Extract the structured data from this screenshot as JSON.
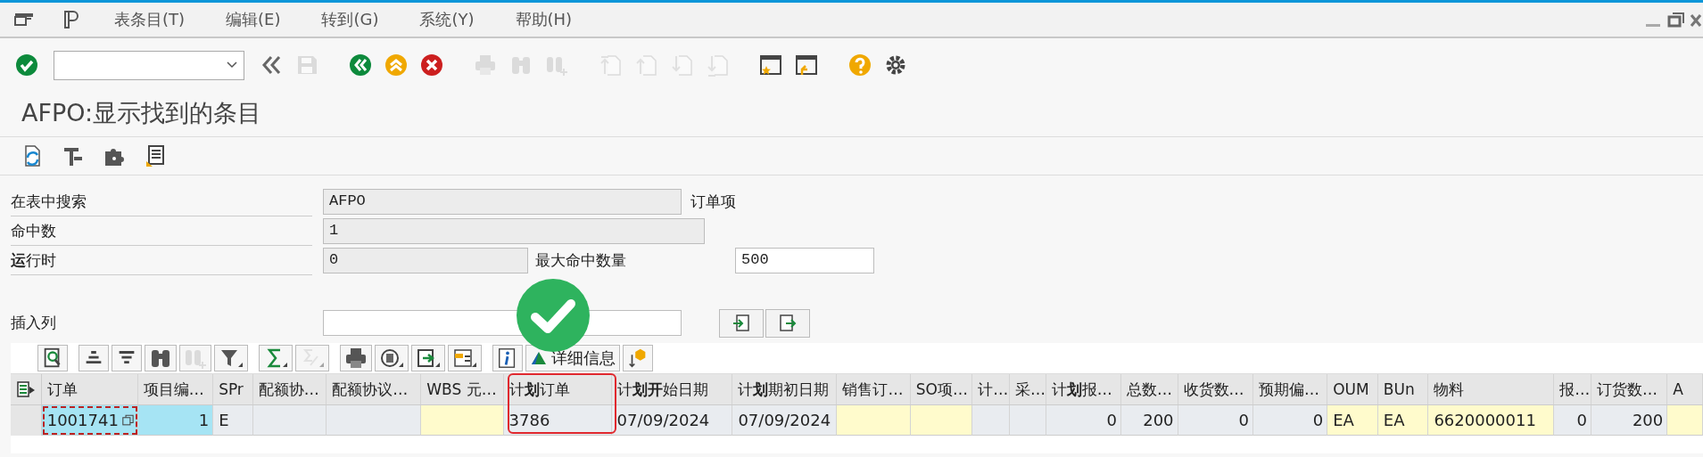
{
  "menu": {
    "items": [
      "表条目(T)",
      "编辑(E)",
      "转到(G)",
      "系统(Y)",
      "帮助(H)"
    ]
  },
  "system_toolbar": [
    {
      "kind": "enter",
      "disabled": false
    },
    {
      "kind": "command-field",
      "disabled": false
    },
    {
      "kind": "collapse",
      "disabled": false
    },
    {
      "kind": "save",
      "disabled": true
    },
    {
      "kind": "sep"
    },
    {
      "kind": "back",
      "disabled": false
    },
    {
      "kind": "exit",
      "disabled": false
    },
    {
      "kind": "cancel",
      "disabled": false
    },
    {
      "kind": "sep"
    },
    {
      "kind": "print",
      "disabled": true
    },
    {
      "kind": "find",
      "disabled": true
    },
    {
      "kind": "find-next",
      "disabled": true
    },
    {
      "kind": "sep"
    },
    {
      "kind": "first-page",
      "disabled": true
    },
    {
      "kind": "prev-page",
      "disabled": true
    },
    {
      "kind": "next-page",
      "disabled": true
    },
    {
      "kind": "last-page",
      "disabled": true
    },
    {
      "kind": "sep"
    },
    {
      "kind": "new-session",
      "disabled": false
    },
    {
      "kind": "shortcut",
      "disabled": false
    },
    {
      "kind": "sep"
    },
    {
      "kind": "help",
      "disabled": false
    },
    {
      "kind": "settings",
      "disabled": false
    }
  ],
  "title": "AFPO:显示找到的条目",
  "app_toolbar": [
    {
      "kind": "refresh"
    },
    {
      "kind": "tools"
    },
    {
      "kind": "puzzle"
    },
    {
      "kind": "document"
    }
  ],
  "search_form": {
    "rows": [
      {
        "label": "在表中搜索",
        "value": "AFPO",
        "disabled": true,
        "note": "订单项"
      },
      {
        "label": "命中数",
        "value": "1",
        "disabled": true
      },
      {
        "label": "**运**行时",
        "value": "0",
        "disabled": true,
        "extra": {
          "label": "最大命中数量",
          "value": "500",
          "disabled": false
        }
      }
    ],
    "insert_column": {
      "label": "插入列",
      "disabled": false
    }
  },
  "table_toolbar": [
    {
      "kind": "details",
      "disabled": false
    },
    {
      "kind": "sep"
    },
    {
      "kind": "sort-asc",
      "disabled": false
    },
    {
      "kind": "sort-desc",
      "disabled": false
    },
    {
      "kind": "find",
      "disabled": false
    },
    {
      "kind": "find-next",
      "disabled": true
    },
    {
      "kind": "filter",
      "disabled": false
    },
    {
      "kind": "sep"
    },
    {
      "kind": "sum",
      "disabled": false
    },
    {
      "kind": "subtotal",
      "disabled": true
    },
    {
      "kind": "sep"
    },
    {
      "kind": "print",
      "disabled": false
    },
    {
      "kind": "views",
      "disabled": false
    },
    {
      "kind": "export",
      "disabled": false
    },
    {
      "kind": "layout",
      "disabled": false
    },
    {
      "kind": "sep"
    },
    {
      "kind": "info",
      "disabled": false
    },
    {
      "kind": "text-button",
      "label": "详细信息",
      "disabled": false
    },
    {
      "kind": "extra",
      "disabled": false
    }
  ],
  "table": {
    "columns": [
      {
        "label": "订单",
        "kind": "key",
        "highlighted": false
      },
      {
        "label": "项目编…",
        "kind": "key",
        "highlighted": false
      },
      {
        "label": "SPr",
        "kind": "display",
        "highlighted": false
      },
      {
        "label": "配额协…",
        "kind": "display",
        "highlighted": false
      },
      {
        "label": "配额协议…",
        "kind": "display",
        "highlighted": false
      },
      {
        "label": "WBS 元…",
        "kind": "input",
        "highlighted": false
      },
      {
        "label": "计**划**订单",
        "kind": "display",
        "highlighted": true
      },
      {
        "label": "计**划开**始日期",
        "kind": "display",
        "highlighted": false
      },
      {
        "label": "计**划**期初日期",
        "kind": "display",
        "highlighted": false
      },
      {
        "label": "销售订…",
        "kind": "input",
        "highlighted": false
      },
      {
        "label": "SO项…",
        "kind": "input",
        "highlighted": false
      },
      {
        "label": "计…",
        "kind": "display",
        "highlighted": false
      },
      {
        "label": "采…",
        "kind": "display",
        "highlighted": false
      },
      {
        "label": "计**划**报…",
        "kind": "display",
        "highlighted": false
      },
      {
        "label": "总数…",
        "kind": "display",
        "highlighted": false
      },
      {
        "label": "收货数…",
        "kind": "display",
        "highlighted": false
      },
      {
        "label": "预期偏…",
        "kind": "display",
        "highlighted": false
      },
      {
        "label": "OUM",
        "kind": "input",
        "highlighted": false
      },
      {
        "label": "BUn",
        "kind": "input",
        "highlighted": false
      },
      {
        "label": "物料",
        "kind": "input",
        "highlighted": false
      },
      {
        "label": "报…",
        "kind": "display",
        "highlighted": false
      },
      {
        "label": "订货数…",
        "kind": "display",
        "highlighted": false
      },
      {
        "label": "A",
        "kind": "input",
        "highlighted": false
      }
    ],
    "rows": [
      {
        "cells": [
          {
            "text": "1001741",
            "focused": true
          },
          {
            "text": "1",
            "focused": false
          },
          {
            "text": "E",
            "focused": false
          },
          {
            "focused": false
          },
          {
            "focused": false
          },
          {
            "focused": false
          },
          {
            "text": "3786",
            "focused": false
          },
          {
            "text": "07/09/2024",
            "focused": false
          },
          {
            "text": "07/09/2024",
            "focused": false
          },
          {
            "focused": false
          },
          {
            "focused": false
          },
          {
            "focused": false
          },
          {
            "focused": false
          },
          {
            "text": "0",
            "focused": false
          },
          {
            "text": "200",
            "focused": false
          },
          {
            "text": "0",
            "focused": false
          },
          {
            "text": "0",
            "focused": false
          },
          {
            "text": "EA",
            "focused": false
          },
          {
            "text": "EA",
            "focused": false
          },
          {
            "text": "6620000011",
            "focused": false
          },
          {
            "text": "0",
            "focused": false
          },
          {
            "text": "200",
            "focused": false
          },
          {
            "focused": false
          }
        ]
      }
    ]
  }
}
